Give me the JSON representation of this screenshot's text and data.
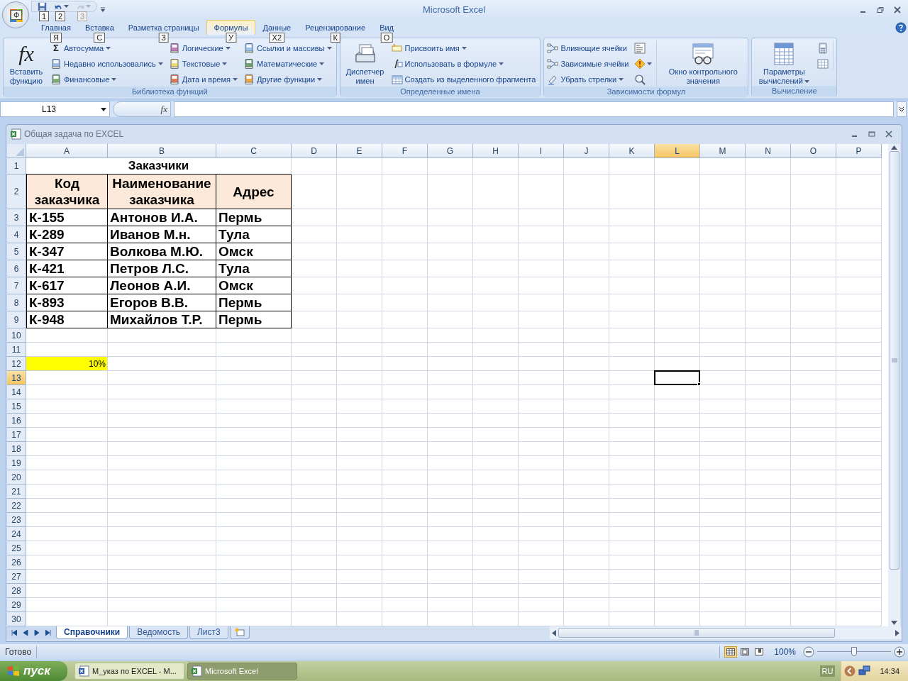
{
  "title_bar": {
    "title": "Microsoft Excel",
    "office_key_tip": "Ф",
    "quick_access": [
      {
        "key_tip": "1",
        "disabled": false
      },
      {
        "key_tip": "2",
        "disabled": false
      },
      {
        "key_tip": "3",
        "disabled": true
      }
    ]
  },
  "tabs": [
    {
      "label": "Главная",
      "key_tip": "Я",
      "selected": false
    },
    {
      "label": "Вставка",
      "key_tip": "С",
      "selected": false
    },
    {
      "label": "Разметка страницы",
      "key_tip": "З",
      "selected": false
    },
    {
      "label": "Формулы",
      "key_tip": "У",
      "selected": true
    },
    {
      "label": "Данные",
      "key_tip": "Х2",
      "selected": false
    },
    {
      "label": "Рецензирование",
      "key_tip": "К",
      "selected": false
    },
    {
      "label": "Вид",
      "key_tip": "О",
      "selected": false
    }
  ],
  "ribbon": {
    "groups": [
      {
        "label": "Библиотека функций",
        "items": [
          {
            "kind": "large",
            "label": "Вставить функцию",
            "icon_text": "fx",
            "dropdown": false
          },
          {
            "kind": "column",
            "items": [
              {
                "label": "Автосумма",
                "icon_text": "Σ",
                "dropdown": true
              },
              {
                "label": "Недавно использовались",
                "dropdown": true
              },
              {
                "label": "Финансовые",
                "dropdown": true
              }
            ]
          },
          {
            "kind": "column",
            "items": [
              {
                "label": "Логические",
                "dropdown": true
              },
              {
                "label": "Текстовые",
                "dropdown": true
              },
              {
                "label": "Дата и время",
                "dropdown": true
              }
            ]
          },
          {
            "kind": "column",
            "items": [
              {
                "label": "Ссылки и массивы",
                "dropdown": true
              },
              {
                "label": "Математические",
                "dropdown": true
              },
              {
                "label": "Другие функции",
                "dropdown": true
              }
            ]
          }
        ]
      },
      {
        "label": "Определенные имена",
        "items": [
          {
            "kind": "large",
            "label": "Диспетчер имен",
            "dropdown": false
          },
          {
            "kind": "column",
            "items": [
              {
                "label": "Присвоить имя",
                "dropdown": true
              },
              {
                "label": "Использовать в формуле",
                "dropdown": true
              },
              {
                "label": "Создать из выделенного фрагмента",
                "dropdown": false
              }
            ]
          }
        ]
      },
      {
        "label": "Зависимости формул",
        "items": [
          {
            "kind": "column",
            "items": [
              {
                "label": "Влияющие ячейки",
                "dropdown": false
              },
              {
                "label": "Зависимые ячейки",
                "dropdown": false
              },
              {
                "label": "Убрать стрелки",
                "dropdown": true
              }
            ]
          },
          {
            "kind": "icons",
            "items": [
              {
                "dropdown": false
              },
              {
                "dropdown": true
              },
              {
                "dropdown": false
              }
            ]
          },
          {
            "kind": "large",
            "label": "Окно контрольного значения",
            "dropdown": false
          }
        ]
      },
      {
        "label": "Вычисление",
        "items": [
          {
            "kind": "large",
            "label": "Параметры вычислений",
            "dropdown": true
          },
          {
            "kind": "icons",
            "items": [
              {
                "dropdown": false
              },
              {
                "dropdown": false
              }
            ]
          }
        ]
      }
    ]
  },
  "formula_bar": {
    "name_box": "L13",
    "fx": "fx"
  },
  "workbook": {
    "title": "Общая задача по EXCEL"
  },
  "sheet": {
    "columns": [
      {
        "label": "A",
        "selected": false
      },
      {
        "label": "B",
        "selected": false
      },
      {
        "label": "C",
        "selected": false
      },
      {
        "label": "D",
        "selected": false
      },
      {
        "label": "E",
        "selected": false
      },
      {
        "label": "F",
        "selected": false
      },
      {
        "label": "G",
        "selected": false
      },
      {
        "label": "H",
        "selected": false
      },
      {
        "label": "I",
        "selected": false
      },
      {
        "label": "J",
        "selected": false
      },
      {
        "label": "K",
        "selected": false
      },
      {
        "label": "L",
        "selected": true
      },
      {
        "label": "M",
        "selected": false
      },
      {
        "label": "N",
        "selected": false
      },
      {
        "label": "O",
        "selected": false
      },
      {
        "label": "P",
        "selected": false
      }
    ],
    "rows": [
      {
        "number": "1",
        "selected": false,
        "kind": "title",
        "cells": [
          "Заказчики"
        ]
      },
      {
        "number": "2",
        "selected": false,
        "kind": "header",
        "cells": [
          "Код заказчика",
          "Наименование заказчика",
          "Адрес"
        ]
      },
      {
        "number": "3",
        "selected": false,
        "kind": "data",
        "cells": [
          "К-155",
          "Антонов И.А.",
          "Пермь"
        ]
      },
      {
        "number": "4",
        "selected": false,
        "kind": "data",
        "cells": [
          "К-289",
          "Иванов М.н.",
          "Тула"
        ]
      },
      {
        "number": "5",
        "selected": false,
        "kind": "data",
        "cells": [
          "К-347",
          "Волкова М.Ю.",
          "Омск"
        ]
      },
      {
        "number": "6",
        "selected": false,
        "kind": "data",
        "cells": [
          "К-421",
          "Петров Л.С.",
          "Тула"
        ]
      },
      {
        "number": "7",
        "selected": false,
        "kind": "data",
        "cells": [
          "К-617",
          "Леонов А.И.",
          "Омск"
        ]
      },
      {
        "number": "8",
        "selected": false,
        "kind": "data",
        "cells": [
          "К-893",
          "Егоров В.В.",
          "Пермь"
        ]
      },
      {
        "number": "9",
        "selected": false,
        "kind": "data",
        "cells": [
          "К-948",
          "Михайлов Т.Р.",
          "Пермь"
        ]
      },
      {
        "number": "10",
        "selected": false,
        "kind": "empty"
      },
      {
        "number": "11",
        "selected": false,
        "kind": "empty"
      },
      {
        "number": "12",
        "selected": false,
        "kind": "percent",
        "cells": [
          "10%"
        ]
      },
      {
        "number": "13",
        "selected": true,
        "kind": "empty"
      },
      {
        "number": "14",
        "selected": false,
        "kind": "empty"
      },
      {
        "number": "15",
        "selected": false,
        "kind": "empty"
      },
      {
        "number": "16",
        "selected": false,
        "kind": "empty"
      },
      {
        "number": "17",
        "selected": false,
        "kind": "empty"
      },
      {
        "number": "18",
        "selected": false,
        "kind": "empty"
      },
      {
        "number": "19",
        "selected": false,
        "kind": "empty"
      },
      {
        "number": "20",
        "selected": false,
        "kind": "empty"
      },
      {
        "number": "21",
        "selected": false,
        "kind": "empty"
      },
      {
        "number": "22",
        "selected": false,
        "kind": "empty"
      },
      {
        "number": "23",
        "selected": false,
        "kind": "empty"
      },
      {
        "number": "24",
        "selected": false,
        "kind": "empty"
      },
      {
        "number": "25",
        "selected": false,
        "kind": "empty"
      },
      {
        "number": "26",
        "selected": false,
        "kind": "empty"
      },
      {
        "number": "27",
        "selected": false,
        "kind": "empty"
      },
      {
        "number": "28",
        "selected": false,
        "kind": "empty"
      },
      {
        "number": "29",
        "selected": false,
        "kind": "empty"
      },
      {
        "number": "30",
        "selected": false,
        "kind": "empty"
      }
    ],
    "tabs": [
      {
        "label": "Справочники",
        "selected": true
      },
      {
        "label": "Ведомость",
        "selected": false
      },
      {
        "label": "Лист3",
        "selected": false
      }
    ]
  },
  "status_bar": {
    "status": "Готово",
    "views": [
      {
        "selected": true
      },
      {
        "selected": false
      },
      {
        "selected": false
      }
    ],
    "zoom": "100%",
    "zoom_slider": {
      "level": 0.5
    }
  },
  "taskbar": {
    "start": "пуск",
    "tasks": [
      {
        "label": "М_указ по EXCEL - М...",
        "selected": false
      },
      {
        "label": "Microsoft Excel",
        "selected": true
      }
    ],
    "language": "RU",
    "clock": "14:34"
  }
}
